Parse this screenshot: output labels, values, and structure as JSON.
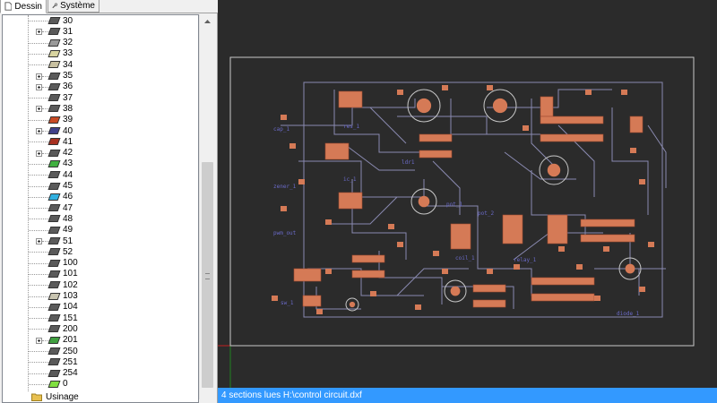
{
  "tabs": [
    {
      "label": "Dessin",
      "icon": "document-icon",
      "active": true
    },
    {
      "label": "Système",
      "icon": "wrench-icon",
      "active": false
    }
  ],
  "layers": [
    {
      "name": "30",
      "color": "#5a5a5a",
      "expandable": false
    },
    {
      "name": "31",
      "color": "#5a5a5a",
      "expandable": true
    },
    {
      "name": "32",
      "color": "#9a9a9a",
      "expandable": false
    },
    {
      "name": "33",
      "color": "#d8d4a0",
      "expandable": false
    },
    {
      "name": "34",
      "color": "#c8c0a0",
      "expandable": false
    },
    {
      "name": "35",
      "color": "#5a5a5a",
      "expandable": true
    },
    {
      "name": "36",
      "color": "#5a5a5a",
      "expandable": true
    },
    {
      "name": "37",
      "color": "#5a5a5a",
      "expandable": false
    },
    {
      "name": "38",
      "color": "#5a5a5a",
      "expandable": true
    },
    {
      "name": "39",
      "color": "#c84a24",
      "expandable": false
    },
    {
      "name": "40",
      "color": "#40408a",
      "expandable": true
    },
    {
      "name": "41",
      "color": "#a83020",
      "expandable": false
    },
    {
      "name": "42",
      "color": "#5a5a5a",
      "expandable": true
    },
    {
      "name": "43",
      "color": "#40b040",
      "expandable": false
    },
    {
      "name": "44",
      "color": "#5a5a5a",
      "expandable": false
    },
    {
      "name": "45",
      "color": "#5a5a5a",
      "expandable": false
    },
    {
      "name": "46",
      "color": "#30b0e0",
      "expandable": false
    },
    {
      "name": "47",
      "color": "#5a5a5a",
      "expandable": false
    },
    {
      "name": "48",
      "color": "#5a5a5a",
      "expandable": false
    },
    {
      "name": "49",
      "color": "#5a5a5a",
      "expandable": false
    },
    {
      "name": "51",
      "color": "#5a5a5a",
      "expandable": true
    },
    {
      "name": "52",
      "color": "#5a5a5a",
      "expandable": false
    },
    {
      "name": "100",
      "color": "#5a5a5a",
      "expandable": false
    },
    {
      "name": "101",
      "color": "#5a5a5a",
      "expandable": false
    },
    {
      "name": "102",
      "color": "#5a5a5a",
      "expandable": false
    },
    {
      "name": "103",
      "color": "#c8c4b0",
      "expandable": false
    },
    {
      "name": "104",
      "color": "#5a5a5a",
      "expandable": false
    },
    {
      "name": "151",
      "color": "#5a5a5a",
      "expandable": false
    },
    {
      "name": "200",
      "color": "#5a5a5a",
      "expandable": false
    },
    {
      "name": "201",
      "color": "#40a040",
      "expandable": true
    },
    {
      "name": "250",
      "color": "#5a5a5a",
      "expandable": false
    },
    {
      "name": "251",
      "color": "#5a5a5a",
      "expandable": false
    },
    {
      "name": "254",
      "color": "#5a5a5a",
      "expandable": false
    },
    {
      "name": "0",
      "color": "#80e040",
      "expandable": false
    }
  ],
  "bottom_item": {
    "label": "Usinage",
    "icon": "folder-icon"
  },
  "status": {
    "text": "4 sections lues H:\\control circuit.dxf"
  },
  "canvas": {
    "pcb_labels": [
      {
        "text": "cap_1"
      },
      {
        "text": "res_1"
      },
      {
        "text": "zener_1"
      },
      {
        "text": "pwm_out"
      },
      {
        "text": "ldr1"
      },
      {
        "text": "ic_1"
      },
      {
        "text": "pot_1"
      },
      {
        "text": "pot_2"
      },
      {
        "text": "coil_1"
      },
      {
        "text": "relay_1"
      },
      {
        "text": "diode_1"
      },
      {
        "text": "sw_1"
      }
    ]
  },
  "colors": {
    "canvas_bg": "#2b2b2b",
    "board_outline": "#c8c8c8",
    "trace": "#8a8ab0",
    "pad": "#d57a56",
    "label": "#6a6ac8",
    "status_bg": "#3399ff",
    "axis_red": "#c02020",
    "axis_green": "#208020"
  }
}
